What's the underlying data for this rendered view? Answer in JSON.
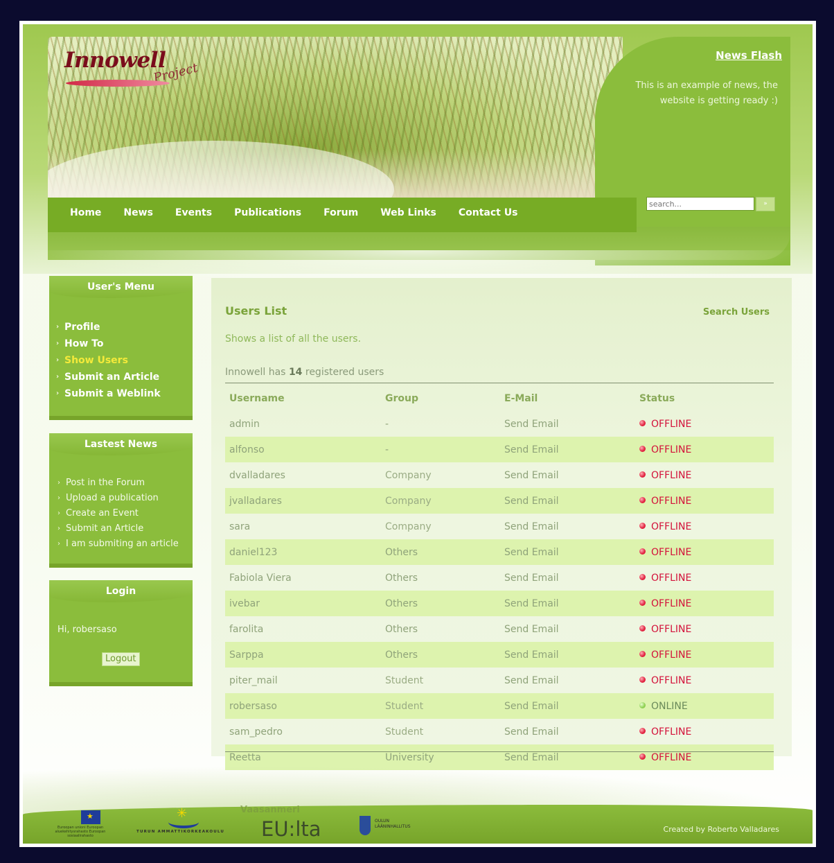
{
  "header": {
    "logo_main": "Innowell",
    "logo_sub": "Project",
    "news_flash_title": "News Flash",
    "news_flash_text": "This is an example of news, the website is getting ready :)",
    "search_placeholder": "search...",
    "search_button": "»"
  },
  "nav": {
    "items": [
      "Home",
      "News",
      "Events",
      "Publications",
      "Forum",
      "Web Links",
      "Contact Us"
    ]
  },
  "sidebar": {
    "user_menu": {
      "title": "User's Menu",
      "items": [
        "Profile",
        "How To",
        "Show Users",
        "Submit an Article",
        "Submit a Weblink"
      ],
      "active": "Show Users"
    },
    "latest_news": {
      "title": "Lastest News",
      "items": [
        "Post in the Forum",
        "Upload a publication",
        "Create an Event",
        "Submit an Article",
        "I am submiting an article"
      ]
    },
    "login": {
      "title": "Login",
      "greeting": "Hi, robersaso",
      "logout_label": "Logout"
    }
  },
  "main": {
    "title": "Users List",
    "search_link": "Search Users",
    "description": "Shows a list of all the users.",
    "count_prefix": "Innowell has",
    "count": "14",
    "count_suffix": "registered users",
    "columns": [
      "Username",
      "Group",
      "E-Mail",
      "Status"
    ],
    "rows": [
      {
        "username": "admin",
        "group": "-",
        "email": "Send Email",
        "status": "OFFLINE"
      },
      {
        "username": "alfonso",
        "group": "-",
        "email": "Send Email",
        "status": "OFFLINE"
      },
      {
        "username": "dvalladares",
        "group": "Company",
        "email": "Send Email",
        "status": "OFFLINE"
      },
      {
        "username": "jvalladares",
        "group": "Company",
        "email": "Send Email",
        "status": "OFFLINE"
      },
      {
        "username": "sara",
        "group": "Company",
        "email": "Send Email",
        "status": "OFFLINE"
      },
      {
        "username": "daniel123",
        "group": "Others",
        "email": "Send Email",
        "status": "OFFLINE"
      },
      {
        "username": "Fabiola Viera",
        "group": "Others",
        "email": "Send Email",
        "status": "OFFLINE"
      },
      {
        "username": "ivebar",
        "group": "Others",
        "email": "Send Email",
        "status": "OFFLINE"
      },
      {
        "username": "farolita",
        "group": "Others",
        "email": "Send Email",
        "status": "OFFLINE"
      },
      {
        "username": "Sarppa",
        "group": "Others",
        "email": "Send Email",
        "status": "OFFLINE"
      },
      {
        "username": "piter_mail",
        "group": "Student",
        "email": "Send Email",
        "status": "OFFLINE"
      },
      {
        "username": "robersaso",
        "group": "Student",
        "email": "Send Email",
        "status": "ONLINE"
      },
      {
        "username": "sam_pedro",
        "group": "Student",
        "email": "Send Email",
        "status": "OFFLINE"
      },
      {
        "username": "Reetta",
        "group": "University",
        "email": "Send Email",
        "status": "OFFLINE"
      }
    ],
    "status_colors": {
      "OFFLINE": "#d3113a",
      "ONLINE": "#6a8a5a"
    }
  },
  "footer": {
    "eu_caption": "Euroopan unioni Euroopan aluekehitysrahasto Euroopan sosiaalirahasto",
    "turku_name": "TURUN AMMATTIKORKEAKOULU",
    "eulta_top": "Vaasanmeri",
    "eulta_main": "EU:lta",
    "oulu_line1": "OULUN",
    "oulu_line2": "LÄÄNINHALLITUS",
    "credits": "Created by Roberto Valladares"
  },
  "colors": {
    "brand_green": "#8bbd3c",
    "nav_green": "#77ac25",
    "active_menu": "#f4ea3a",
    "alt_row": "#ddf3ae"
  }
}
